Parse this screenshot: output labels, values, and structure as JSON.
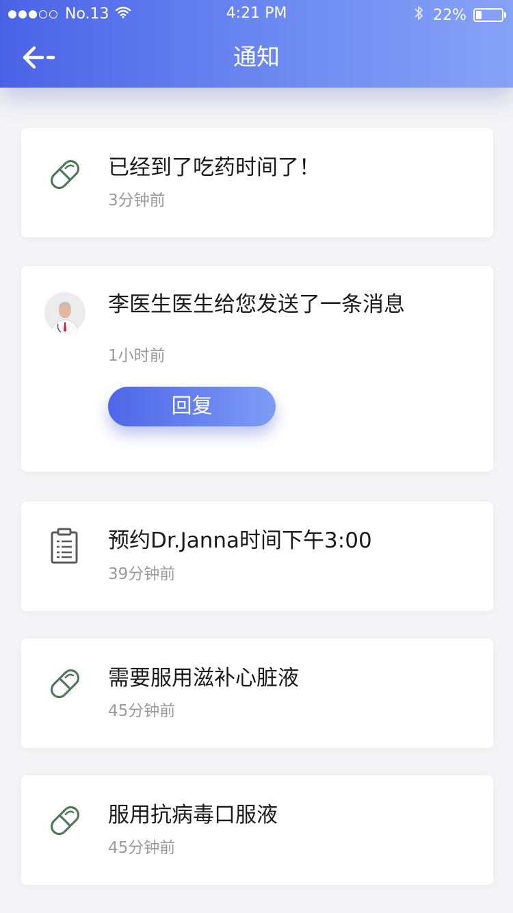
{
  "status_bar": {
    "carrier": "No.13",
    "time": "4:21 PM",
    "battery": "22%",
    "battery_level": 0.22,
    "signal_strength": "3 of 5"
  },
  "nav": {
    "title": "通知",
    "back_icon": "arrow-left-icon"
  },
  "colors": {
    "header_gradient_start": "#4a63e6",
    "header_gradient_end": "#86a2f7",
    "pill_icon": "#4f7a5a",
    "time_text": "#9a9a9a"
  },
  "notifications": [
    {
      "icon": "pill-icon",
      "title": "已经到了吃药时间了！",
      "time": "3分钟前"
    },
    {
      "icon": "doctor-avatar",
      "title": "李医生医生给您发送了一条消息",
      "time": "1小时前",
      "action_label": "回复"
    },
    {
      "icon": "clipboard-icon",
      "title": "预约Dr.Janna时间下午3:00",
      "time": "39分钟前"
    },
    {
      "icon": "pill-icon",
      "title": "需要服用滋补心脏液",
      "time": "45分钟前"
    },
    {
      "icon": "pill-icon",
      "title": "服用抗病毒口服液",
      "time": "45分钟前"
    }
  ]
}
